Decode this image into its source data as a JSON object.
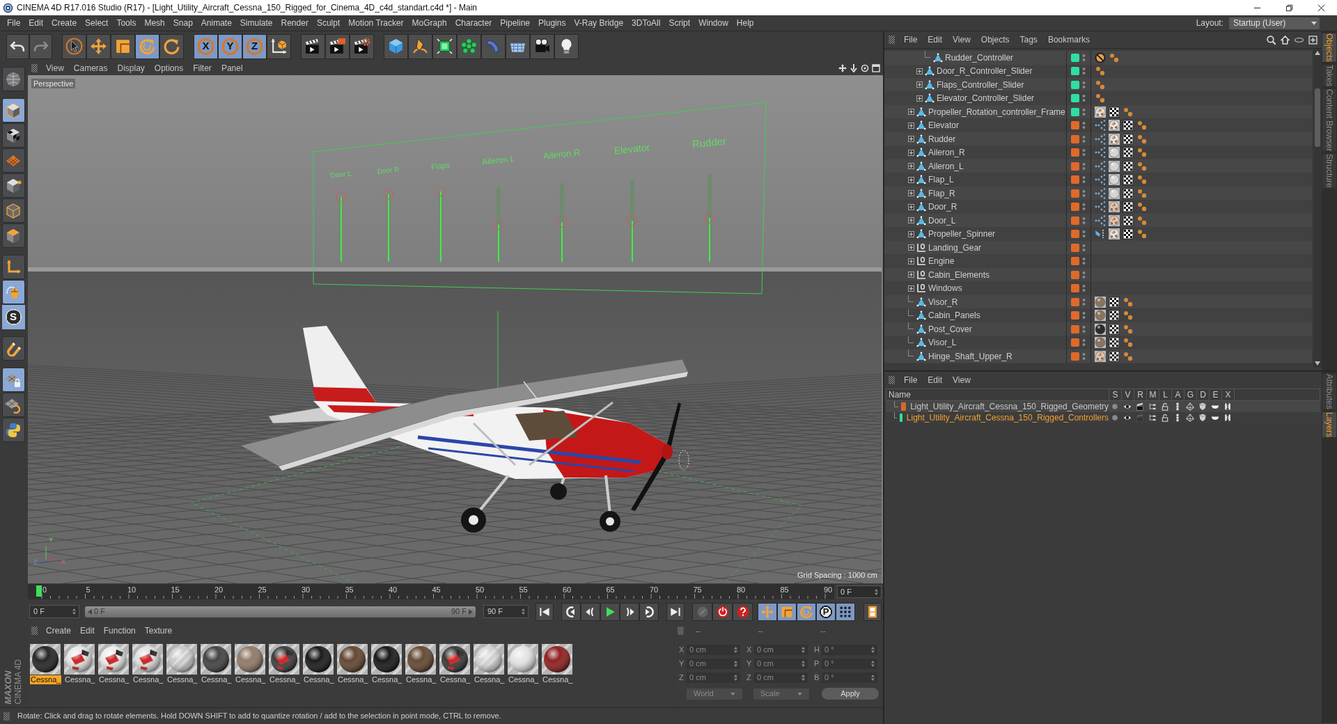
{
  "window": {
    "title": "CINEMA 4D R17.016 Studio (R17) - [Light_Utility_Aircraft_Cessna_150_Rigged_for_Cinema_4D_c4d_standart.c4d *] - Main"
  },
  "menu_bar": {
    "items": [
      "File",
      "Edit",
      "Create",
      "Select",
      "Tools",
      "Mesh",
      "Snap",
      "Animate",
      "Simulate",
      "Render",
      "Sculpt",
      "Motion Tracker",
      "MoGraph",
      "Character",
      "Pipeline",
      "Plugins",
      "V-Ray Bridge",
      "3DToAll",
      "Script",
      "Window",
      "Help"
    ],
    "layout_label": "Layout:",
    "layout_value": "Startup (User)"
  },
  "toolbar": [
    [
      {
        "kind": "undo",
        "disabled": false
      },
      {
        "kind": "redo",
        "disabled": true
      }
    ],
    [
      {
        "kind": "select",
        "selected": false
      },
      {
        "kind": "move",
        "selected": false
      },
      {
        "kind": "scale",
        "selected": false
      },
      {
        "kind": "rotate",
        "selected": true
      },
      {
        "kind": "recent",
        "selected": false
      }
    ],
    [
      {
        "kind": "axis",
        "label": "X",
        "selected": true
      },
      {
        "kind": "axis",
        "label": "Y",
        "selected": true
      },
      {
        "kind": "axis",
        "label": "Z",
        "selected": true
      },
      {
        "kind": "coords",
        "selected": false
      }
    ],
    [
      {
        "kind": "render_view"
      },
      {
        "kind": "render_picture"
      },
      {
        "kind": "render_settings"
      }
    ],
    [
      {
        "kind": "cube"
      },
      {
        "kind": "pen"
      },
      {
        "kind": "subdivision"
      },
      {
        "kind": "cloner"
      },
      {
        "kind": "deformer"
      },
      {
        "kind": "floor"
      },
      {
        "kind": "camera"
      },
      {
        "kind": "light"
      }
    ]
  ],
  "left_tools": [
    [
      {
        "kind": "make_editable",
        "selected": false
      }
    ],
    [
      {
        "kind": "model",
        "selected": true
      },
      {
        "kind": "texture",
        "selected": false
      },
      {
        "kind": "workplane",
        "selected": false
      },
      {
        "kind": "points",
        "selected": false
      },
      {
        "kind": "edges",
        "selected": false
      },
      {
        "kind": "polygons",
        "selected": false
      }
    ],
    [
      {
        "kind": "axis",
        "selected": false
      },
      {
        "kind": "tweak",
        "selected": true
      },
      {
        "kind": "solo",
        "label": "S",
        "selected": true
      }
    ],
    [
      {
        "kind": "snap",
        "selected": false
      }
    ],
    [
      {
        "kind": "workplane_lock",
        "selected": true
      },
      {
        "kind": "planar",
        "selected": false
      },
      {
        "kind": "python",
        "selected": false
      }
    ]
  ],
  "logo": {
    "brand": "MAXON",
    "product": "CINEMA 4D"
  },
  "viewport": {
    "menu": [
      "View",
      "Cameras",
      "Display",
      "Options",
      "Filter",
      "Panel"
    ],
    "camera": "Perspective",
    "sliders": [
      {
        "label": "Door L",
        "level": 1
      },
      {
        "label": "Door R",
        "level": 1
      },
      {
        "label": "Flaps",
        "level": 1
      },
      {
        "label": "Aileron L",
        "level": 0.5
      },
      {
        "label": "Aileron R",
        "level": 0.5
      },
      {
        "label": "Elevator",
        "level": 0.5
      },
      {
        "label": "Rudder",
        "level": 0.5
      }
    ],
    "axis_labels": [
      "Y",
      "Z",
      "X"
    ],
    "grid_spacing": "Grid Spacing : 1000 cm"
  },
  "timeline": {
    "ticks": [
      "0",
      "5",
      "10",
      "15",
      "20",
      "25",
      "30",
      "35",
      "40",
      "45",
      "50",
      "55",
      "60",
      "65",
      "70",
      "75",
      "80",
      "85",
      "90"
    ],
    "playhead": {
      "level": 0
    },
    "frame_field": "0 F"
  },
  "transport": {
    "start_field": "0 F",
    "range_slider": {
      "start": "0 F",
      "end": "90 F",
      "level": 1
    },
    "end_field": "90 F",
    "buttons": [
      [
        {
          "kind": "go_start"
        }
      ],
      [
        {
          "kind": "prev_key"
        },
        {
          "kind": "prev_frame"
        },
        {
          "kind": "play"
        },
        {
          "kind": "next_frame"
        },
        {
          "kind": "next_key"
        }
      ],
      [
        {
          "kind": "go_end"
        }
      ],
      [
        {
          "kind": "keyframe",
          "disabled": true
        },
        {
          "kind": "record",
          "disabled": false
        },
        {
          "kind": "autokey",
          "disabled": false
        }
      ],
      [
        {
          "kind": "key_move",
          "selected": true
        },
        {
          "kind": "key_scale",
          "selected": true
        },
        {
          "kind": "key_rotate",
          "selected": true
        },
        {
          "kind": "letter",
          "label": "P",
          "selected": true
        },
        {
          "kind": "key_pla",
          "selected": true
        }
      ],
      [
        {
          "kind": "timeline"
        }
      ]
    ]
  },
  "materials": {
    "menu": [
      "Create",
      "Edit",
      "Function",
      "Texture"
    ],
    "items": [
      {
        "name": "Cessna_",
        "kind": "plain",
        "color": "#1a1a1a",
        "selected": true
      },
      {
        "name": "Cessna_",
        "kind": "livery",
        "color": "#e6e6e6",
        "selected": false
      },
      {
        "name": "Cessna_",
        "kind": "livery",
        "color": "#ececec",
        "selected": false
      },
      {
        "name": "Cessna_",
        "kind": "livery",
        "color": "#e0e0e0",
        "selected": false
      },
      {
        "name": "Cessna_",
        "kind": "glass",
        "color": "#c8c8c8",
        "selected": false
      },
      {
        "name": "Cessna_",
        "kind": "plain",
        "color": "#3a3a3a",
        "selected": false
      },
      {
        "name": "Cessna_",
        "kind": "plain",
        "color": "#8c7462",
        "selected": false
      },
      {
        "name": "Cessna_",
        "kind": "livery",
        "color": "#333333",
        "selected": false
      },
      {
        "name": "Cessna_",
        "kind": "plain",
        "color": "#0e0e0e",
        "selected": false
      },
      {
        "name": "Cessna_",
        "kind": "plain",
        "color": "#5a3e28",
        "selected": false
      },
      {
        "name": "Cessna_",
        "kind": "plain",
        "color": "#0c0c0c",
        "selected": false
      },
      {
        "name": "Cessna_",
        "kind": "plain",
        "color": "#5e4028",
        "selected": false
      },
      {
        "name": "Cessna_",
        "kind": "livery",
        "color": "#2e2e2e",
        "selected": false
      },
      {
        "name": "Cessna_",
        "kind": "glass",
        "color": "#d2d2d2",
        "selected": false
      },
      {
        "name": "Cessna_",
        "kind": "plain",
        "color": "#e4e4e4",
        "selected": false
      },
      {
        "name": "Cessna_",
        "kind": "plain",
        "color": "#8a1414",
        "selected": false
      }
    ]
  },
  "coordinates": {
    "headers": [
      "--",
      "--",
      "--"
    ],
    "rows": [
      {
        "axis": "X",
        "position": "0 cm",
        "size_axis": "X",
        "size": "0 cm",
        "rotation_axis": "H",
        "rotation": "0 °"
      },
      {
        "axis": "Y",
        "position": "0 cm",
        "size_axis": "Y",
        "size": "0 cm",
        "rotation_axis": "P",
        "rotation": "0 °"
      },
      {
        "axis": "Z",
        "position": "0 cm",
        "size_axis": "Z",
        "size": "0 cm",
        "rotation_axis": "B",
        "rotation": "0 °"
      }
    ],
    "coord_system": "World",
    "size_mode": "Scale",
    "apply": "Apply"
  },
  "status_bar": {
    "text": "Rotate: Click and drag to rotate elements. Hold DOWN SHIFT to add to quantize rotation / add to the selection in point mode, CTRL to remove."
  },
  "object_manager": {
    "menu": [
      "File",
      "Edit",
      "View",
      "Objects",
      "Tags",
      "Bookmarks"
    ],
    "objects": [
      {
        "children": [
          {
            "children": [
              {
                "children": [
                  {
                    "name": "Rudder_Controller",
                    "kind": "polygon",
                    "has_children": false,
                    "color": "#2ee0a0",
                    "tags": [
                      {
                        "kind": "protection"
                      },
                      {
                        "kind": "points"
                      }
                    ]
                  }
                ]
              },
              {
                "name": "Door_R_Controller_Slider",
                "kind": "polygon",
                "has_children": true,
                "color": "#2ee0a0",
                "tags": [
                  {
                    "kind": "points"
                  }
                ]
              },
              {
                "name": "Flaps_Controller_Slider",
                "kind": "polygon",
                "has_children": true,
                "color": "#2ee0a0",
                "tags": [
                  {
                    "kind": "points"
                  }
                ]
              },
              {
                "name": "Elevator_Controller_Slider",
                "kind": "polygon",
                "has_children": true,
                "color": "#2ee0a0",
                "tags": [
                  {
                    "kind": "points"
                  }
                ]
              }
            ]
          },
          {
            "name": "Propeller_Rotation_controller_Frame",
            "kind": "polygon",
            "has_children": true,
            "color": "#2ee0a0",
            "tags": [
              {
                "kind": "material",
                "color": "#dedede",
                "textured": true
              },
              {
                "kind": "uvw"
              },
              {
                "kind": "points"
              }
            ]
          },
          {
            "name": "Elevator",
            "kind": "polygon",
            "has_children": true,
            "color": "#e0692a",
            "tags": [
              {
                "kind": "link"
              },
              {
                "kind": "material",
                "color": "#e2e2e2",
                "textured": true
              },
              {
                "kind": "uvw"
              },
              {
                "kind": "points"
              }
            ]
          },
          {
            "name": "Rudder",
            "kind": "polygon",
            "has_children": true,
            "color": "#e0692a",
            "tags": [
              {
                "kind": "link"
              },
              {
                "kind": "material",
                "color": "#e2e2e2",
                "textured": true
              },
              {
                "kind": "uvw"
              },
              {
                "kind": "points"
              }
            ]
          },
          {
            "name": "Aileron_R",
            "kind": "polygon",
            "has_children": true,
            "color": "#e0692a",
            "tags": [
              {
                "kind": "link"
              },
              {
                "kind": "material",
                "color": "#d4d4d4",
                "textured": false
              },
              {
                "kind": "uvw"
              },
              {
                "kind": "points"
              }
            ]
          },
          {
            "name": "Aileron_L",
            "kind": "polygon",
            "has_children": true,
            "color": "#e0692a",
            "tags": [
              {
                "kind": "link"
              },
              {
                "kind": "material",
                "color": "#d4d4d4",
                "textured": false
              },
              {
                "kind": "uvw"
              },
              {
                "kind": "points"
              }
            ]
          },
          {
            "name": "Flap_L",
            "kind": "polygon",
            "has_children": true,
            "color": "#e0692a",
            "tags": [
              {
                "kind": "link"
              },
              {
                "kind": "material",
                "color": "#d4d4d4",
                "textured": false
              },
              {
                "kind": "uvw"
              },
              {
                "kind": "points"
              }
            ]
          },
          {
            "name": "Flap_R",
            "kind": "polygon",
            "has_children": true,
            "color": "#e0692a",
            "tags": [
              {
                "kind": "link"
              },
              {
                "kind": "material",
                "color": "#d4d4d4",
                "textured": false
              },
              {
                "kind": "uvw"
              },
              {
                "kind": "points"
              }
            ]
          },
          {
            "name": "Door_R",
            "kind": "polygon",
            "has_children": true,
            "color": "#e0692a",
            "tags": [
              {
                "kind": "link"
              },
              {
                "kind": "material",
                "color": "#d8c4b4",
                "textured": true
              },
              {
                "kind": "uvw"
              },
              {
                "kind": "points"
              }
            ]
          },
          {
            "name": "Door_L",
            "kind": "polygon",
            "has_children": true,
            "color": "#e0692a",
            "tags": [
              {
                "kind": "link"
              },
              {
                "kind": "material",
                "color": "#d8c4b4",
                "textured": true
              },
              {
                "kind": "uvw"
              },
              {
                "kind": "points"
              }
            ]
          },
          {
            "name": "Propeller_Spinner",
            "kind": "polygon",
            "has_children": true,
            "color": "#e0692a",
            "tags": [
              {
                "kind": "psr"
              },
              {
                "kind": "material",
                "color": "#e2e2e2",
                "textured": true
              },
              {
                "kind": "uvw"
              },
              {
                "kind": "points"
              }
            ]
          },
          {
            "name": "Landing_Gear",
            "kind": "null",
            "has_children": true,
            "color": "#e0692a"
          },
          {
            "name": "Engine",
            "kind": "null",
            "has_children": true,
            "color": "#e0692a"
          },
          {
            "name": "Cabin_Elements",
            "kind": "null",
            "has_children": true,
            "color": "#e0692a"
          },
          {
            "name": "Windows",
            "kind": "null",
            "has_children": true,
            "color": "#e0692a"
          },
          {
            "name": "Visor_R",
            "kind": "polygon",
            "has_children": false,
            "color": "#e0692a",
            "tags": [
              {
                "kind": "material",
                "color": "#8a7460",
                "textured": false
              },
              {
                "kind": "uvw"
              },
              {
                "kind": "points"
              }
            ]
          },
          {
            "name": "Cabin_Panels",
            "kind": "polygon",
            "has_children": false,
            "color": "#e0692a",
            "tags": [
              {
                "kind": "material",
                "color": "#8a7460",
                "textured": false
              },
              {
                "kind": "uvw"
              },
              {
                "kind": "points"
              }
            ]
          },
          {
            "name": "Post_Cover",
            "kind": "polygon",
            "has_children": false,
            "color": "#e0692a",
            "tags": [
              {
                "kind": "material",
                "color": "#2c2c2c",
                "textured": false
              },
              {
                "kind": "uvw"
              },
              {
                "kind": "points"
              }
            ]
          },
          {
            "name": "Visor_L",
            "kind": "polygon",
            "has_children": false,
            "color": "#e0692a",
            "tags": [
              {
                "kind": "material",
                "color": "#8a7460",
                "textured": false
              },
              {
                "kind": "uvw"
              },
              {
                "kind": "points"
              }
            ]
          },
          {
            "name": "Hinge_Shaft_Upper_R",
            "kind": "polygon",
            "has_children": false,
            "color": "#e0692a",
            "tags": [
              {
                "kind": "material",
                "color": "#d8c4b4",
                "textured": true
              },
              {
                "kind": "uvw"
              },
              {
                "kind": "points"
              }
            ]
          }
        ]
      }
    ]
  },
  "layer_manager": {
    "menu": [
      "File",
      "Edit",
      "View"
    ],
    "columns": [
      "Name",
      "S",
      "V",
      "R",
      "M",
      "L",
      "A",
      "G",
      "D",
      "E",
      "X"
    ],
    "layers": [
      {
        "name": "Light_Utility_Aircraft_Cessna_150_Rigged_Geometry",
        "color": "#d5692a",
        "selected": false,
        "render": true
      },
      {
        "name": "Light_Utility_Aircraft_Cessna_150_Rigged_Controllers",
        "color": "#2ee0a0",
        "selected": true,
        "render": false
      }
    ]
  },
  "side_tabs": {
    "upper": [
      {
        "label": "Objects",
        "selected": true
      },
      {
        "label": "Takes",
        "selected": false
      },
      {
        "label": "Content Browser",
        "selected": false
      },
      {
        "label": "Structure",
        "selected": false
      }
    ],
    "lower": [
      {
        "label": "Attributes",
        "selected": false
      },
      {
        "label": "Layers",
        "selected": true
      }
    ]
  }
}
